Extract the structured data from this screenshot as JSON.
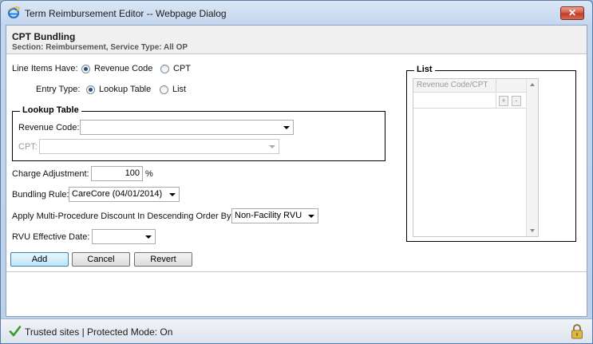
{
  "window": {
    "title": "Term Reimbursement Editor -- Webpage Dialog",
    "close_label": "✕"
  },
  "header": {
    "title": "CPT Bundling",
    "subtitle": "Section: Reimbursement, Service Type: All OP"
  },
  "line_items": {
    "label": "Line Items Have:",
    "options": [
      {
        "label": "Revenue Code",
        "selected": true
      },
      {
        "label": "CPT",
        "selected": false
      }
    ]
  },
  "entry_type": {
    "label": "Entry Type:",
    "options": [
      {
        "label": "Lookup Table",
        "selected": true
      },
      {
        "label": "List",
        "selected": false
      }
    ]
  },
  "lookup_table": {
    "legend": "Lookup Table",
    "revenue_code_label": "Revenue Code:",
    "revenue_code_value": "",
    "cpt_label": "CPT:",
    "cpt_value": ""
  },
  "charge_adjustment": {
    "label": "Charge Adjustment:",
    "value": "100",
    "unit": "%"
  },
  "bundling_rule": {
    "label": "Bundling Rule:",
    "value": "CareCore (04/01/2014)"
  },
  "multi_procedure": {
    "label": "Apply Multi-Procedure Discount In Descending Order By:",
    "value": "Non-Facility RVU"
  },
  "rvu_effective_date": {
    "label": "RVU Effective Date:",
    "value": ""
  },
  "list_panel": {
    "legend": "List",
    "column_header": "Revenue Code/CPT",
    "add_label": "+",
    "remove_label": "-"
  },
  "actions": {
    "add_label": "Add",
    "cancel_label": "Cancel",
    "revert_label": "Revert"
  },
  "status_bar": {
    "text": "Trusted sites | Protected Mode: On"
  },
  "colors": {
    "accent": "#2a4f7c",
    "title_bar": "#c4d6ee",
    "close_button": "#c13a22",
    "trusted_check": "#3a9a2a"
  },
  "icons": [
    "ie-icon",
    "close-icon",
    "check-icon",
    "lock-icon",
    "chevron-down-icon"
  ]
}
